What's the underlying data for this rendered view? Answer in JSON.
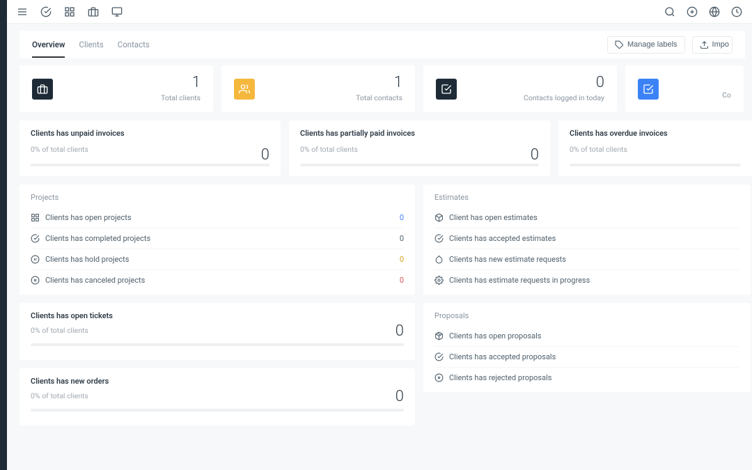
{
  "tabs": {
    "overview": "Overview",
    "clients": "Clients",
    "contacts": "Contacts"
  },
  "actions": {
    "manage_labels": "Manage labels",
    "import": "Impo"
  },
  "stats": {
    "total_clients": {
      "value": "1",
      "label": "Total clients"
    },
    "total_contacts": {
      "value": "1",
      "label": "Total contacts"
    },
    "logged_today": {
      "value": "0",
      "label": "Contacts logged in today"
    },
    "extra": {
      "label_cut": "Co"
    }
  },
  "pct_cards": {
    "unpaid": {
      "title": "Clients has unpaid invoices",
      "sub": "0% of total clients",
      "value": "0"
    },
    "partial": {
      "title": "Clients has partially paid invoices",
      "sub": "0% of total clients",
      "value": "0"
    },
    "overdue": {
      "title": "Clients has overdue invoices",
      "sub": "0% of total clients"
    }
  },
  "projects": {
    "title": "Projects",
    "open": {
      "label": "Clients has open projects",
      "value": "0"
    },
    "completed": {
      "label": "Clients has completed projects",
      "value": "0"
    },
    "hold": {
      "label": "Clients has hold projects",
      "value": "0"
    },
    "canceled": {
      "label": "Clients has canceled projects",
      "value": "0"
    }
  },
  "estimates": {
    "title": "Estimates",
    "open": "Client has open estimates",
    "accepted": "Clients has accepted estimates",
    "new_req": "Clients has new estimate requests",
    "in_progress": "Clients has estimate requests in progress"
  },
  "tickets": {
    "title": "Clients has open tickets",
    "sub": "0% of total clients",
    "value": "0"
  },
  "orders": {
    "title": "Clients has new orders",
    "sub": "0% of total clients",
    "value": "0"
  },
  "proposals": {
    "title": "Proposals",
    "open": "Clients has open proposals",
    "accepted": "Clients has accepted proposals",
    "rejected": "Clients has rejected proposals"
  }
}
